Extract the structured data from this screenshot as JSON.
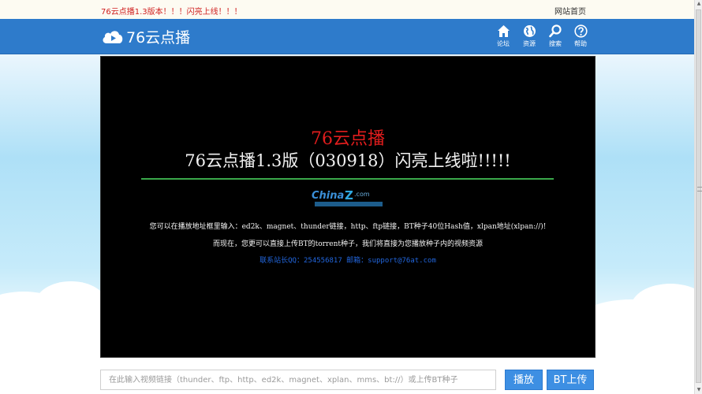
{
  "topbar": {
    "notice": "76云点播1.3版本！！！闪亮上线！！！",
    "home_link": "网站首页"
  },
  "header": {
    "logo_text": "76云点播",
    "nav": [
      {
        "label": "论坛",
        "icon": "home-icon"
      },
      {
        "label": "资源",
        "icon": "globe-icon"
      },
      {
        "label": "搜索",
        "icon": "search-icon"
      },
      {
        "label": "帮助",
        "icon": "help-icon"
      }
    ]
  },
  "player": {
    "brand": "76云点播",
    "headline": "76云点播1.3版（030918）闪亮上线啦!!!!!",
    "line1": "您可以在播放地址框里输入：ed2k、magnet、thunder链接，http、ftp链接，BT种子40位Hash值，xlpan地址(xlpan://)!",
    "line2": "而现在，您更可以直接上传BT的torrent种子，我们将直接为您播放种子内的视频资源",
    "contact": "联系站长QQ：254556817 邮箱：support@76at.com"
  },
  "search": {
    "placeholder": "在此输入视频链接（thunder、ftp、http、ed2k、magnet、xplan、mms、bt://）或上传BT种子",
    "play_label": "播放",
    "upload_label": "BT上传"
  },
  "colors": {
    "header_blue": "#2e7bcb",
    "button_blue": "#3d8fe3",
    "brand_red": "#e11d1d",
    "rule_green": "#3aa84a",
    "contact_blue": "#2266dd"
  }
}
